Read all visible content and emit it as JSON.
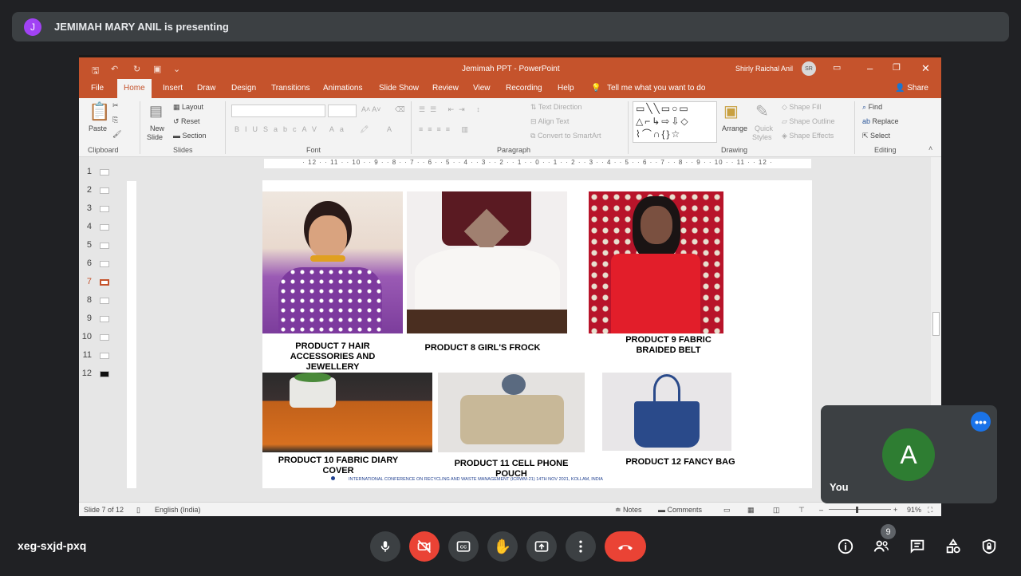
{
  "meet": {
    "presenter_initial": "J",
    "presenting_text": "JEMIMAH MARY ANIL is presenting",
    "meeting_code": "xeg-sxjd-pxq",
    "self_label": "You",
    "self_initial": "A",
    "participants_count": "9"
  },
  "ppt": {
    "title": "Jemimah PPT  -  PowerPoint",
    "user_name": "Shirly Raichal Anil",
    "user_initials": "SR",
    "tabs": [
      "File",
      "Home",
      "Insert",
      "Draw",
      "Design",
      "Transitions",
      "Animations",
      "Slide Show",
      "Review",
      "View",
      "Recording",
      "Help"
    ],
    "tell_me": "Tell me what you want to do",
    "share": "Share",
    "ribbon": {
      "paste": "Paste",
      "clipboard": "Clipboard",
      "new_slide_1": "New",
      "new_slide_2": "Slide",
      "layout": "Layout",
      "reset": "Reset",
      "section": "Section",
      "slides": "Slides",
      "font": "Font",
      "text_direction": "Text Direction",
      "align_text": "Align Text",
      "convert_smartart": "Convert to SmartArt",
      "paragraph": "Paragraph",
      "arrange": "Arrange",
      "quick_styles_1": "Quick",
      "quick_styles_2": "Styles",
      "shape_fill": "Shape Fill",
      "shape_outline": "Shape Outline",
      "shape_effects": "Shape Effects",
      "drawing": "Drawing",
      "find": "Find",
      "replace": "Replace",
      "select": "Select",
      "editing": "Editing"
    },
    "ruler_text": "· 12 · · 11 · · 10 · · 9 · · 8 · · 7 · · 6 · · 5 · · 4 · · 3 · · 2 · · 1 · · 0 · · 1 · · 2 · · 3 · · 4 · · 5 · · 6 · · 7 · · 8 · · 9 · · 10 · · 11 · · 12 ·",
    "thumbs": [
      "1",
      "2",
      "3",
      "4",
      "5",
      "6",
      "7",
      "8",
      "9",
      "10",
      "11",
      "12"
    ],
    "selected_slide": "7",
    "slide": {
      "cap7": "PRODUCT 7 HAIR ACCESSORIES AND JEWELLERY",
      "cap8": "PRODUCT 8 GIRL'S FROCK",
      "cap9": "PRODUCT 9 FABRIC BRAIDED BELT",
      "cap10": "PRODUCT 10 FABRIC DIARY COVER",
      "cap11": "PRODUCT 11 CELL PHONE POUCH",
      "cap12": "PRODUCT 12 FANCY BAG",
      "footer": "INTERNATIONAL CONFERENCE ON RECYCLING AND WASTE MANAGEMENT (ICRWM-21) 14TH NOV 2021, KOLLAM, INDIA"
    },
    "status": {
      "slide_of": "Slide 7 of 12",
      "language": "English (India)",
      "notes": "Notes",
      "comments": "Comments",
      "zoom": "91%"
    }
  },
  "colors": {
    "ppt_accent": "#c5532c",
    "meet_bg": "#202124",
    "end_call": "#ea4335"
  }
}
